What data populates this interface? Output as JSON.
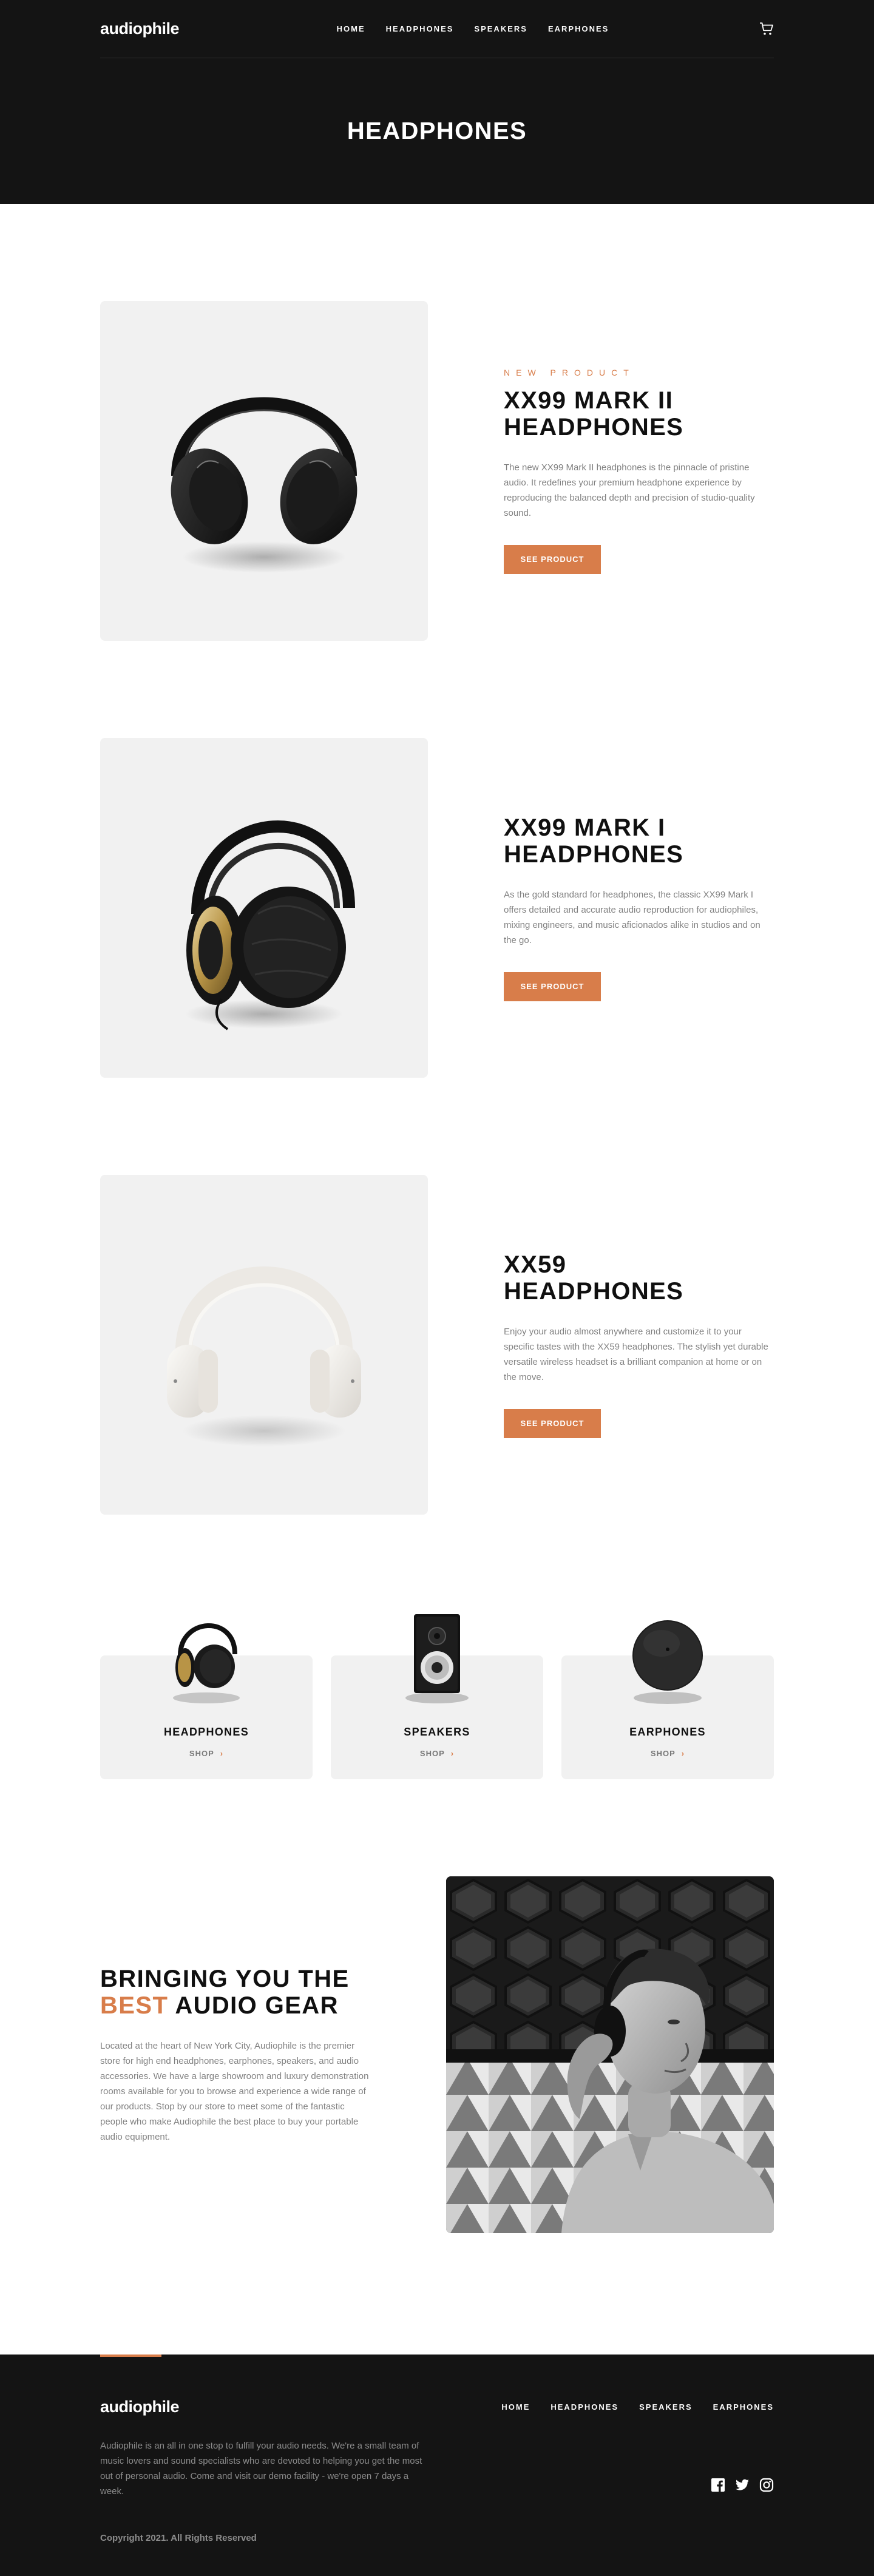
{
  "brand": {
    "name": "audiophile",
    "accent": "#d87d4a",
    "dark": "#141414",
    "light_gray": "#f1f1f1"
  },
  "nav": {
    "links": [
      "HOME",
      "HEADPHONES",
      "SPEAKERS",
      "EARPHONES"
    ],
    "cart_icon": "cart-icon"
  },
  "page": {
    "title": "HEADPHONES"
  },
  "products": [
    {
      "overline": "NEW PRODUCT",
      "name": "XX99 MARK II HEADPHONES",
      "description": "The new XX99 Mark II headphones is the pinnacle of pristine audio. It redefines your premium headphone experience by reproducing the balanced depth and precision of studio-quality sound.",
      "button": "SEE PRODUCT"
    },
    {
      "overline": "",
      "name": "XX99 MARK I HEADPHONES",
      "description": "As the gold standard for headphones, the classic XX99 Mark I offers detailed and accurate audio reproduction for audiophiles, mixing engineers, and music aficionados alike in studios and on the go.",
      "button": "SEE PRODUCT"
    },
    {
      "overline": "",
      "name": "XX59 HEADPHONES",
      "description": "Enjoy your audio almost anywhere and customize it to your specific tastes with the XX59 headphones. The stylish yet durable versatile wireless headset is a brilliant companion at home or on the move.",
      "button": "SEE PRODUCT"
    }
  ],
  "categories": [
    {
      "title": "HEADPHONES",
      "shop": "SHOP"
    },
    {
      "title": "SPEAKERS",
      "shop": "SHOP"
    },
    {
      "title": "EARPHONES",
      "shop": "SHOP"
    }
  ],
  "about": {
    "title_line1": "BRINGING YOU THE",
    "title_accent": "BEST",
    "title_line2_rest": "AUDIO GEAR",
    "description": "Located at the heart of New York City, Audiophile is the premier store for high end headphones, earphones, speakers, and audio accessories. We have a large showroom and luxury demonstration rooms available for you to browse and experience a wide range of our products. Stop by our store to meet some of the fantastic people who make Audiophile the best place to buy your portable audio equipment."
  },
  "footer": {
    "logo": "audiophile",
    "links": [
      "HOME",
      "HEADPHONES",
      "SPEAKERS",
      "EARPHONES"
    ],
    "description": "Audiophile is an all in one stop to fulfill your audio needs. We're a small team of music lovers and sound specialists who are devoted to helping you get the most out of personal audio. Come and visit our demo facility - we're open 7 days a week.",
    "copyright": "Copyright 2021. All Rights Reserved",
    "socials": [
      "facebook-icon",
      "twitter-icon",
      "instagram-icon"
    ]
  }
}
